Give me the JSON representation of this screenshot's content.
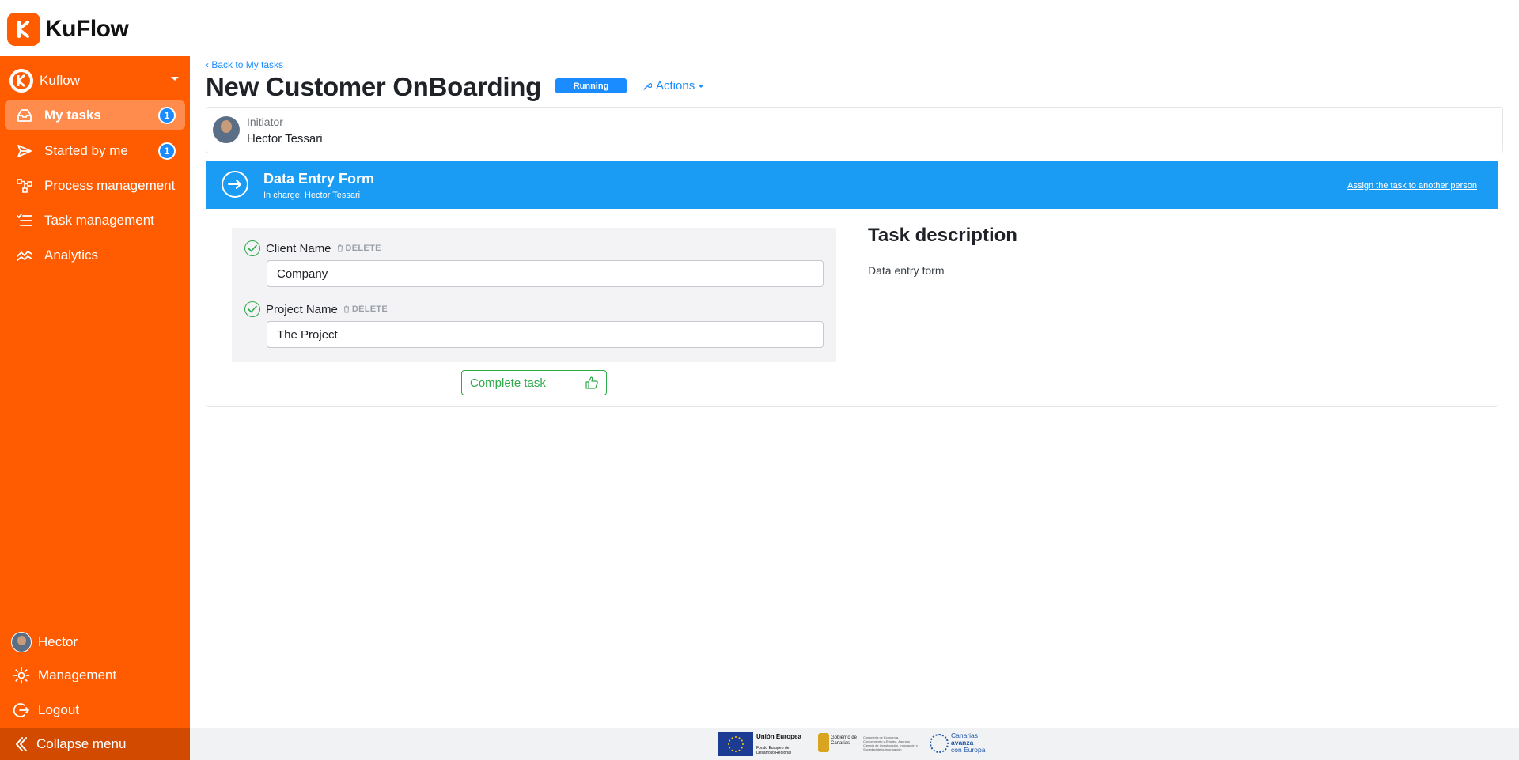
{
  "app": {
    "name": "KuFlow",
    "brand_color": "#ff5b00",
    "accent_color": "#1a8cff",
    "success_color": "#2eaa4a"
  },
  "sidebar": {
    "workspace": "Kuflow",
    "items": [
      {
        "label": "My tasks",
        "icon": "inbox-icon",
        "badge": "1",
        "active": true
      },
      {
        "label": "Started by me",
        "icon": "send-icon",
        "badge": "1",
        "active": false
      },
      {
        "label": "Process management",
        "icon": "process-icon",
        "badge": "",
        "active": false
      },
      {
        "label": "Task management",
        "icon": "task-list-icon",
        "badge": "",
        "active": false
      },
      {
        "label": "Analytics",
        "icon": "analytics-icon",
        "badge": "",
        "active": false
      }
    ],
    "bottom": {
      "user": "Hector",
      "management": "Management",
      "logout": "Logout",
      "collapse": "Collapse menu"
    }
  },
  "page": {
    "back_link": "Back to My tasks",
    "title": "New Customer OnBoarding",
    "status": "Running",
    "actions": "Actions"
  },
  "initiator": {
    "label": "Initiator",
    "name": "Hector Tessari"
  },
  "task": {
    "title": "Data Entry Form",
    "in_charge": "In charge: Hector Tessari",
    "assign_link": "Assign the task to another person",
    "fields": [
      {
        "label": "Client Name",
        "delete": "DELETE",
        "value": "Company"
      },
      {
        "label": "Project Name",
        "delete": "DELETE",
        "value": "The Project"
      }
    ],
    "complete_button": "Complete task",
    "description_title": "Task description",
    "description_text": "Data entry form"
  },
  "footer": {
    "eu_title": "Unión Europea",
    "eu_sub": "Fondo Europeo de Desarrollo Regional",
    "gob": "Gobierno de Canarias",
    "gob_sub": "Consejería de Economía, Conocimiento y Empleo. Agencia Canaria de Investigación, Innovación y Sociedad de la Información",
    "canarias_1": "Canarias",
    "canarias_2": "avanza",
    "canarias_3": "con Europa"
  }
}
